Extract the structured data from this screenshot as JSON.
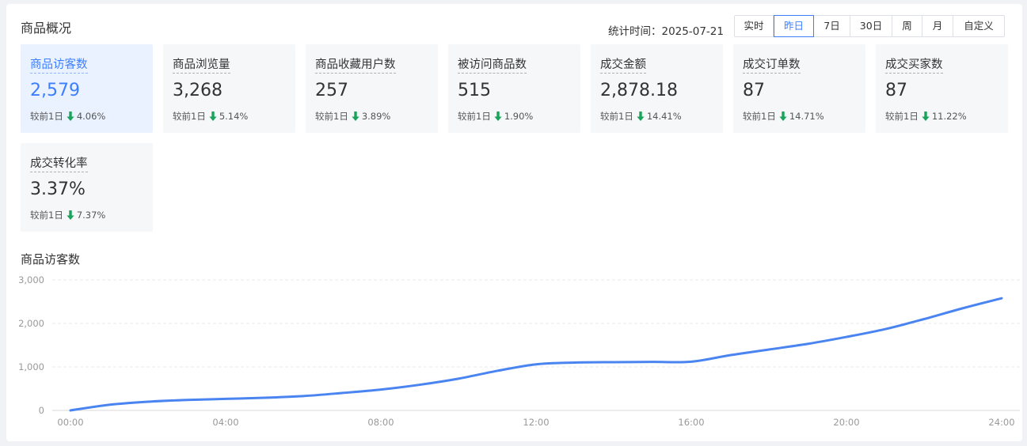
{
  "header": {
    "title": "商品概况",
    "stat_time_label": "统计时间：",
    "stat_time_value": "2025-07-21",
    "ranges": [
      {
        "label": "实时",
        "active": false
      },
      {
        "label": "昨日",
        "active": true
      },
      {
        "label": "7日",
        "active": false
      },
      {
        "label": "30日",
        "active": false
      },
      {
        "label": "周",
        "active": false
      },
      {
        "label": "月",
        "active": false
      },
      {
        "label": "自定义",
        "active": false
      }
    ]
  },
  "cards": [
    {
      "label": "商品访客数",
      "value": "2,579",
      "compare_label": "较前1日",
      "change": "4.06%",
      "trend": "down",
      "active": true
    },
    {
      "label": "商品浏览量",
      "value": "3,268",
      "compare_label": "较前1日",
      "change": "5.14%",
      "trend": "down",
      "active": false
    },
    {
      "label": "商品收藏用户数",
      "value": "257",
      "compare_label": "较前1日",
      "change": "3.89%",
      "trend": "down",
      "active": false
    },
    {
      "label": "被访问商品数",
      "value": "515",
      "compare_label": "较前1日",
      "change": "1.90%",
      "trend": "down",
      "active": false
    },
    {
      "label": "成交金额",
      "value": "2,878.18",
      "compare_label": "较前1日",
      "change": "14.41%",
      "trend": "down",
      "active": false
    },
    {
      "label": "成交订单数",
      "value": "87",
      "compare_label": "较前1日",
      "change": "14.71%",
      "trend": "down",
      "active": false
    },
    {
      "label": "成交买家数",
      "value": "87",
      "compare_label": "较前1日",
      "change": "11.22%",
      "trend": "down",
      "active": false
    },
    {
      "label": "成交转化率",
      "value": "3.37%",
      "compare_label": "较前1日",
      "change": "7.37%",
      "trend": "down",
      "active": false
    }
  ],
  "colors": {
    "accent": "#3d7eff",
    "down": "#1aa35a",
    "line": "#4a84f0",
    "grid": "#e8e8e8",
    "axis_text": "#999999"
  },
  "chart_data": {
    "type": "line",
    "title": "商品访客数",
    "x": [
      "00:00",
      "01:00",
      "02:00",
      "03:00",
      "04:00",
      "05:00",
      "06:00",
      "07:00",
      "08:00",
      "09:00",
      "10:00",
      "11:00",
      "12:00",
      "13:00",
      "14:00",
      "15:00",
      "16:00",
      "17:00",
      "18:00",
      "19:00",
      "20:00",
      "21:00",
      "22:00",
      "23:00",
      "24:00"
    ],
    "xticks": [
      "00:00",
      "04:00",
      "08:00",
      "12:00",
      "16:00",
      "20:00",
      "24:00"
    ],
    "series": [
      {
        "values": [
          0,
          130,
          200,
          240,
          265,
          290,
          330,
          400,
          480,
          590,
          730,
          910,
          1060,
          1100,
          1110,
          1115,
          1120,
          1270,
          1400,
          1530,
          1690,
          1870,
          2100,
          2350,
          2579
        ]
      }
    ],
    "ylim": [
      0,
      3000
    ],
    "yticks": [
      "0",
      "1,000",
      "2,000",
      "3,000"
    ],
    "ytick_values": [
      0,
      1000,
      2000,
      3000
    ],
    "grid": true
  }
}
